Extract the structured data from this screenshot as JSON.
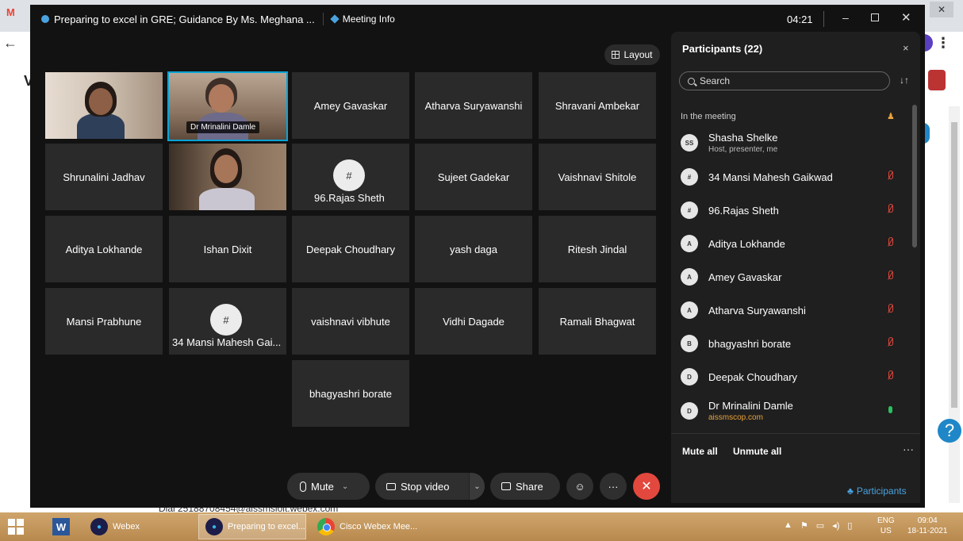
{
  "window": {
    "title": "Preparing to excel in GRE; Guidance By Ms. Meghana ...",
    "meeting_info": "Meeting Info",
    "time": "04:21",
    "minimize": "–",
    "close": "✕"
  },
  "background_page": {
    "dial_text": "Dial 25188708454@aissmsioit.webex.com",
    "help": "?"
  },
  "layout_button": "Layout",
  "tiles": {
    "r1c1": "",
    "r1c2_tag": "Dr Mrinalini Damle",
    "r1c3": "Amey Gavaskar",
    "r1c4": "Atharva Suryawanshi",
    "r1c5": "Shravani Ambekar",
    "r2c1": "Shrunalini Jadhav",
    "r2c3_avatar": "#",
    "r2c3_name": "96.Rajas Sheth",
    "r2c4": "Sujeet Gadekar",
    "r2c5": "Vaishnavi Shitole",
    "r3c1": "Aditya Lokhande",
    "r3c2": "Ishan Dixit",
    "r3c3": "Deepak Choudhary",
    "r3c4": "yash daga",
    "r3c5": "Ritesh Jindal",
    "r4c1": "Mansi Prabhune",
    "r4c2_avatar": "#",
    "r4c2_name": "34 Mansi Mahesh Gai...",
    "r4c3": "vaishnavi vibhute",
    "r4c4": "Vidhi Dagade",
    "r4c5": "Ramali Bhagwat",
    "r5c3": "bhagyashri borate"
  },
  "panel": {
    "title": "Participants (22)",
    "close": "×",
    "search_placeholder": "Search",
    "section": "In the meeting",
    "participants": [
      {
        "initials": "SS",
        "name": "Shasha Shelke",
        "sub": "Host, presenter, me",
        "mic": "none"
      },
      {
        "initials": "#",
        "name": "34 Mansi Mahesh Gaikwad",
        "sub": "",
        "mic": "muted"
      },
      {
        "initials": "#",
        "name": "96.Rajas Sheth",
        "sub": "",
        "mic": "muted"
      },
      {
        "initials": "A",
        "name": "Aditya Lokhande",
        "sub": "",
        "mic": "muted"
      },
      {
        "initials": "A",
        "name": "Amey Gavaskar",
        "sub": "",
        "mic": "muted"
      },
      {
        "initials": "A",
        "name": "Atharva Suryawanshi",
        "sub": "",
        "mic": "muted"
      },
      {
        "initials": "B",
        "name": "bhagyashri borate",
        "sub": "",
        "mic": "muted"
      },
      {
        "initials": "D",
        "name": "Deepak Choudhary",
        "sub": "",
        "mic": "muted"
      },
      {
        "initials": "D",
        "name": "Dr Mrinalini Damle",
        "sub": "aissmscop.com",
        "mic": "live"
      }
    ],
    "mute_all": "Mute all",
    "unmute_all": "Unmute all",
    "more": "···",
    "tab_label": "Participants"
  },
  "controls": {
    "mute": "Mute",
    "stop_video": "Stop video",
    "share": "Share",
    "more": "···",
    "leave": "✕"
  },
  "taskbar": {
    "word": "W",
    "webex": "Webex",
    "meeting": "Preparing to excel...",
    "chrome": "Cisco Webex Mee...",
    "lang_top": "ENG",
    "lang_bottom": "US",
    "time": "09:04",
    "date": "18-11-2021"
  }
}
